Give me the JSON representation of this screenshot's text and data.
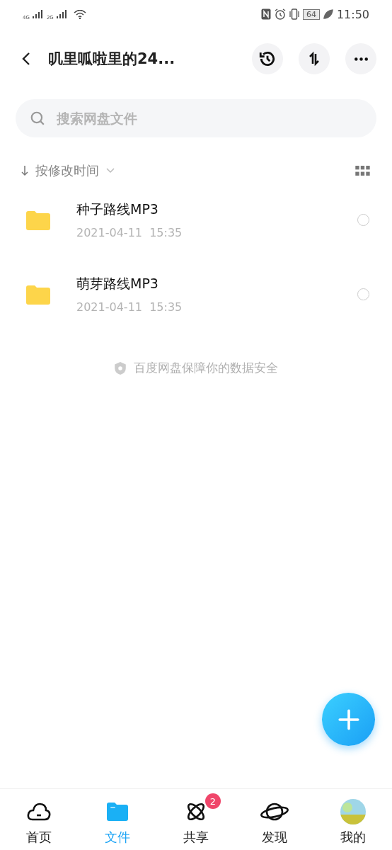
{
  "status_bar": {
    "network_1": "4G",
    "network_2": "2G",
    "battery": "64",
    "time": "11:50"
  },
  "header": {
    "title": "叽里呱啦里的24..."
  },
  "search": {
    "placeholder": "搜索网盘文件"
  },
  "sort": {
    "label": "按修改时间"
  },
  "files": [
    {
      "name": "种子路线MP3",
      "date": "2021-04-11  15:35",
      "selected": false
    },
    {
      "name": "萌芽路线MP3",
      "date": "2021-04-11  15:35",
      "selected": false
    }
  ],
  "footer_note": "百度网盘保障你的数据安全",
  "tabs": [
    {
      "kind": "home",
      "label": "首页",
      "selected": false
    },
    {
      "kind": "files",
      "label": "文件",
      "selected": true
    },
    {
      "kind": "share",
      "label": "共享",
      "selected": false,
      "badge": "2"
    },
    {
      "kind": "discover",
      "label": "发现",
      "selected": false
    },
    {
      "kind": "me",
      "label": "我的",
      "selected": false
    }
  ]
}
